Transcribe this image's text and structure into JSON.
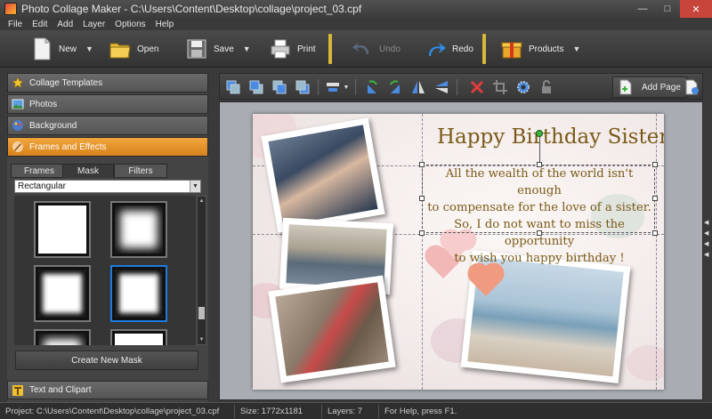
{
  "window": {
    "title": "Photo Collage Maker - C:\\Users\\Content\\Desktop\\collage\\project_03.cpf"
  },
  "menu": [
    "File",
    "Edit",
    "Add",
    "Layer",
    "Options",
    "Help"
  ],
  "toolbar": {
    "new": "New",
    "open": "Open",
    "save": "Save",
    "print": "Print",
    "undo": "Undo",
    "redo": "Redo",
    "products": "Products"
  },
  "sidebar": {
    "categories": [
      "Collage Templates",
      "Photos",
      "Background",
      "Frames and Effects"
    ],
    "tabs": [
      "Frames",
      "Mask",
      "Filters"
    ],
    "mask_select": "Rectangular",
    "create_mask": "Create New Mask",
    "text_clipart": "Text and Clipart"
  },
  "edit_toolbar": {
    "add_page": "Add Page"
  },
  "canvas": {
    "heading": "Happy Birthday Sister !",
    "body_lines": [
      "All the wealth of the world isn't enough",
      "to compensate for the love of a sister.",
      "So, I do not want to miss the opportunity",
      "to wish you happy birthday !"
    ]
  },
  "status": {
    "project": "Project: C:\\Users\\Content\\Desktop\\collage\\project_03.cpf",
    "size": "Size: 1772x1181",
    "layers": "Layers: 7",
    "help": "For Help, press F1."
  },
  "colors": {
    "accent": "#e8962a",
    "selection": "#1e7be0",
    "text_gold": "#7a5a18",
    "separator": "#d7b93a"
  }
}
